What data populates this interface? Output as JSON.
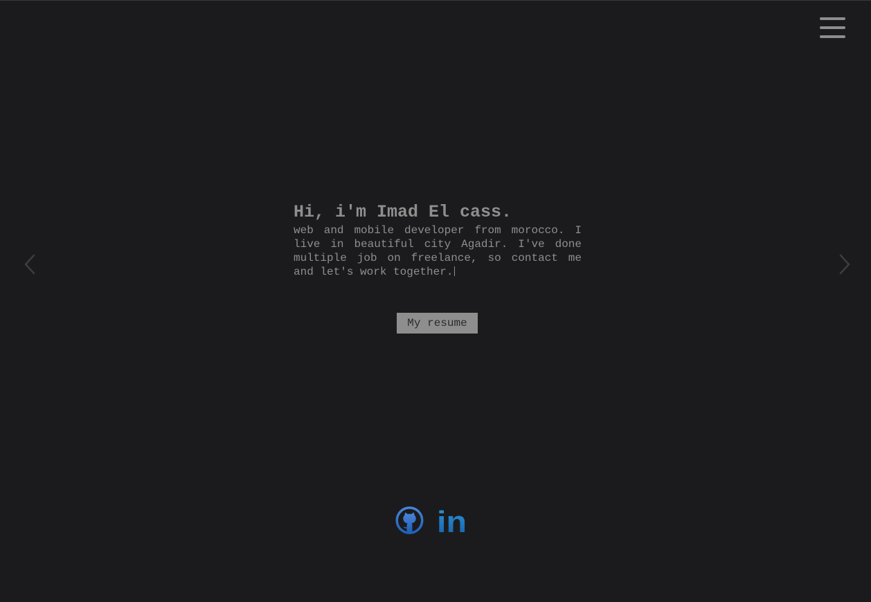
{
  "header": {
    "menu_icon": "hamburger-menu-icon"
  },
  "carousel": {
    "prev_icon": "chevron-left-icon",
    "next_icon": "chevron-right-icon"
  },
  "hero": {
    "title": "Hi, i'm Imad El cass.",
    "text": "web and mobile developer from morocco. I live in beautiful city Agadir. I've done multiple job on freelance, so contact me and let's work together.",
    "resume_label": "My resume"
  },
  "social": {
    "github_icon": "github-icon",
    "linkedin_icon": "linkedin-icon",
    "linkedin_text": "in",
    "colors": {
      "github": "#2f6fc6",
      "linkedin": "#1b7fc7"
    }
  },
  "colors": {
    "background": "#1b1b1d",
    "text": "#8e8e8e",
    "button_bg": "#8e8e8e",
    "button_text": "#2a2a2c"
  }
}
